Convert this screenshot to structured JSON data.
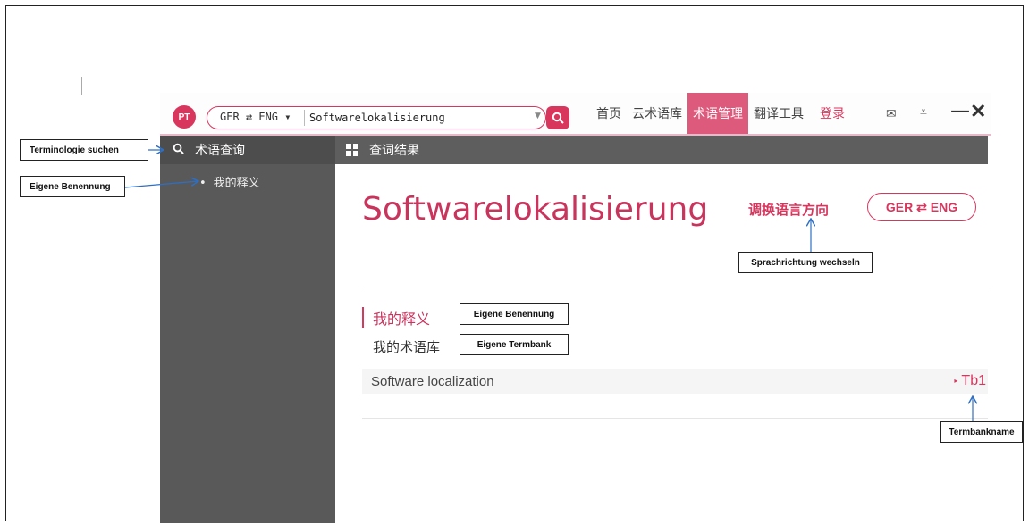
{
  "app": {
    "logo_text": "PT",
    "lang_selector": "GER ⇄ ENG ▾",
    "search_value": "Softwarelokalisierung",
    "nav": [
      "首页",
      "云术语库",
      "术语管理",
      "翻译工具"
    ],
    "nav_active": "术语管理",
    "login": "登录",
    "accent_color": "#d9365e"
  },
  "sidebar": {
    "header": "术语查询",
    "items": [
      {
        "label": "我的释义"
      }
    ]
  },
  "main": {
    "header": "查词结果",
    "term_title": "Softwarelokalisierung",
    "switch_label": "调换语言方向",
    "lang_pill": "GER ⇄ ENG",
    "section_my_definition": "我的释义",
    "section_my_termbank": "我的术语库",
    "result": {
      "term": "Software localization",
      "termbank": "Tb1"
    }
  },
  "annotations": {
    "terminologie_suchen": "Terminologie suchen",
    "eigene_benennung_sidebar": "Eigene Benennung",
    "eigene_benennung_main": "Eigene Benennung",
    "eigene_termbank": "Eigene Termbank",
    "sprachrichtung": "Sprachrichtung wechseln",
    "termbankname": "Termbankname"
  }
}
